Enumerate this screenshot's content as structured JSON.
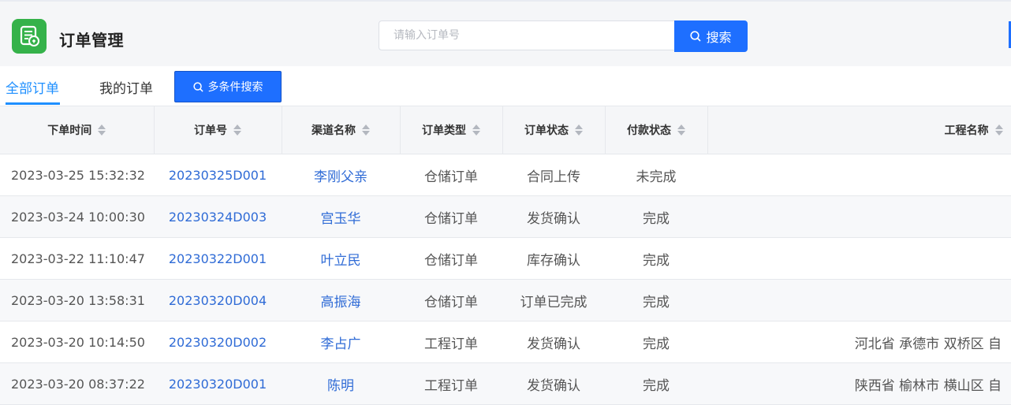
{
  "header": {
    "app_title": "订单管理",
    "logo_icon": "order-list-icon",
    "brand_color": "#35b24a"
  },
  "search": {
    "placeholder": "请输入订单号",
    "button_label": "搜索",
    "accent": "#1e6fff"
  },
  "tabs": {
    "all_orders": "全部订单",
    "my_orders": "我的订单",
    "multi_search_label": "多条件搜索"
  },
  "table": {
    "columns": [
      "下单时间",
      "订单号",
      "渠道名称",
      "订单类型",
      "订单状态",
      "付款状态",
      "工程名称"
    ],
    "rows": [
      {
        "time": "2023-03-25 15:32:32",
        "order_no": "20230325D001",
        "channel": "李刚父亲",
        "type": "仓储订单",
        "status": "合同上传",
        "payment": "未完成",
        "project": ""
      },
      {
        "time": "2023-03-24 10:00:30",
        "order_no": "20230324D003",
        "channel": "宫玉华",
        "type": "仓储订单",
        "status": "发货确认",
        "payment": "完成",
        "project": ""
      },
      {
        "time": "2023-03-22 11:10:47",
        "order_no": "20230322D001",
        "channel": "叶立民",
        "type": "仓储订单",
        "status": "库存确认",
        "payment": "完成",
        "project": ""
      },
      {
        "time": "2023-03-20 13:58:31",
        "order_no": "20230320D004",
        "channel": "高振海",
        "type": "仓储订单",
        "status": "订单已完成",
        "payment": "完成",
        "project": ""
      },
      {
        "time": "2023-03-20 10:14:50",
        "order_no": "20230320D002",
        "channel": "李占广",
        "type": "工程订单",
        "status": "发货确认",
        "payment": "完成",
        "project": "河北省 承德市 双桥区 自"
      },
      {
        "time": "2023-03-20 08:37:22",
        "order_no": "20230320D001",
        "channel": "陈明",
        "type": "工程订单",
        "status": "发货确认",
        "payment": "完成",
        "project": "陕西省 榆林市 横山区 自"
      }
    ]
  }
}
